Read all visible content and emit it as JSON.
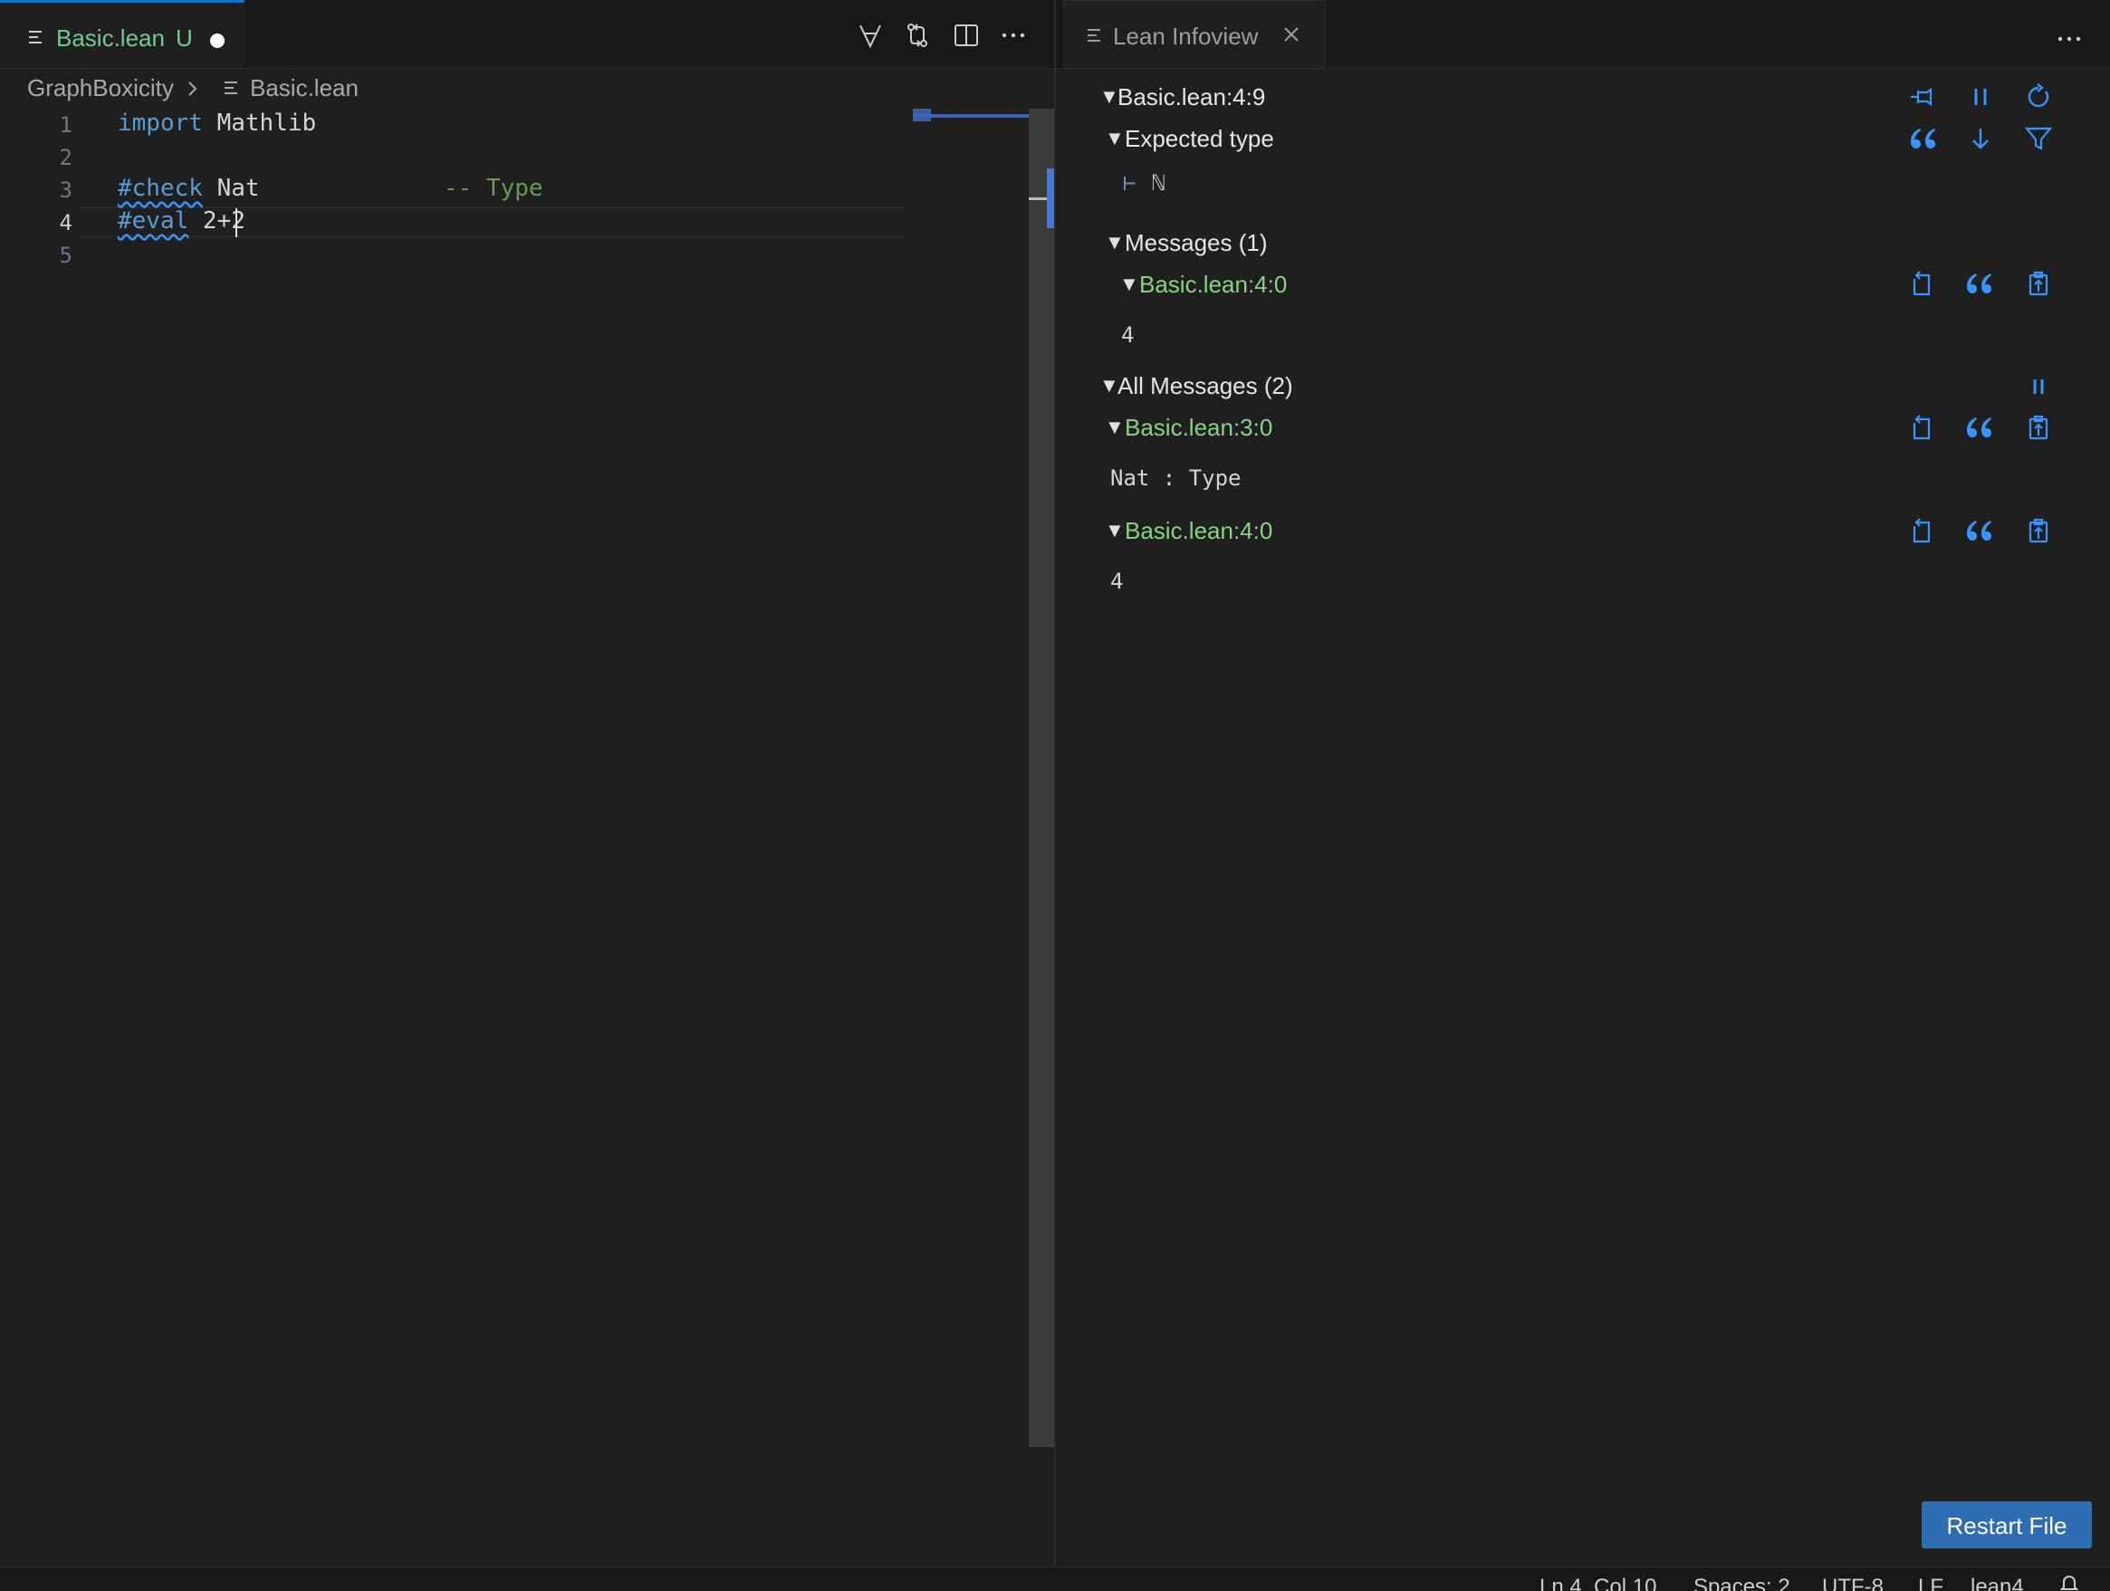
{
  "editor": {
    "tab": {
      "title": "Basic.lean",
      "status": "U"
    },
    "breadcrumb": {
      "folder": "GraphBoxicity",
      "file": "Basic.lean"
    },
    "lines": [
      {
        "number": "1",
        "parts": [
          "import",
          " Mathlib"
        ]
      },
      {
        "number": "2",
        "parts": []
      },
      {
        "number": "3",
        "parts": [
          "#check",
          " Nat",
          "-- Type"
        ]
      },
      {
        "number": "4",
        "parts": [
          "#eval",
          " 2+2"
        ]
      },
      {
        "number": "5",
        "parts": []
      }
    ],
    "active_line": "4"
  },
  "infoview": {
    "tab_title": "Lean Infoview",
    "position_header": "Basic.lean:4:9",
    "expected_type": {
      "label": "Expected type",
      "goal_turnstile": "⊢",
      "goal": "ℕ"
    },
    "messages": {
      "label": "Messages (1)",
      "items": [
        {
          "location": "Basic.lean:4:0",
          "content": "4"
        }
      ]
    },
    "all_messages": {
      "label": "All Messages (2)",
      "items": [
        {
          "location": "Basic.lean:3:0",
          "content": "Nat : Type"
        },
        {
          "location": "Basic.lean:4:0",
          "content": "4"
        }
      ]
    },
    "restart_button": "Restart File"
  },
  "statusbar": {
    "position": "Ln 4, Col 10",
    "spaces": "Spaces: 2",
    "encoding": "UTF-8",
    "eol": "LF",
    "language": "lean4"
  },
  "colors": {
    "accent": "#3794ff",
    "location_green": "#89d185",
    "button_blue": "#2f6db3"
  }
}
